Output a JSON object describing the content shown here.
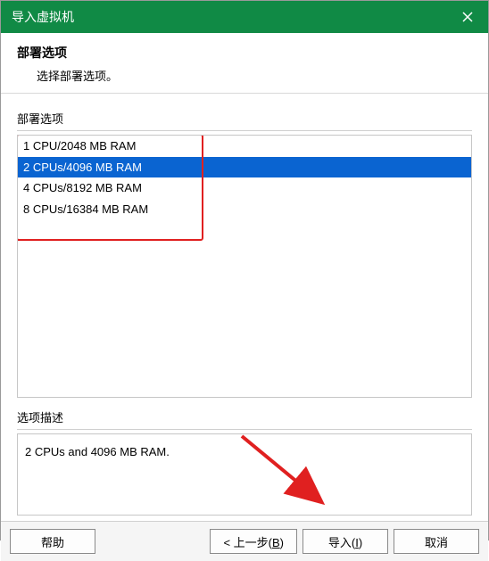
{
  "window": {
    "title": "导入虚拟机"
  },
  "header": {
    "title": "部署选项",
    "subtitle": "选择部署选项。"
  },
  "options": {
    "label": "部署选项",
    "items": [
      "1 CPU/2048 MB RAM",
      "2 CPUs/4096 MB RAM",
      "4 CPUs/8192 MB RAM",
      "8 CPUs/16384 MB RAM"
    ],
    "selected_index": 1
  },
  "description": {
    "label": "选项描述",
    "text": "2 CPUs and 4096 MB RAM."
  },
  "buttons": {
    "help": "帮助",
    "back_prefix": "< 上一步(",
    "back_key": "B",
    "back_suffix": ")",
    "import_prefix": "导入(",
    "import_key": "I",
    "import_suffix": ")",
    "cancel": "取消"
  }
}
